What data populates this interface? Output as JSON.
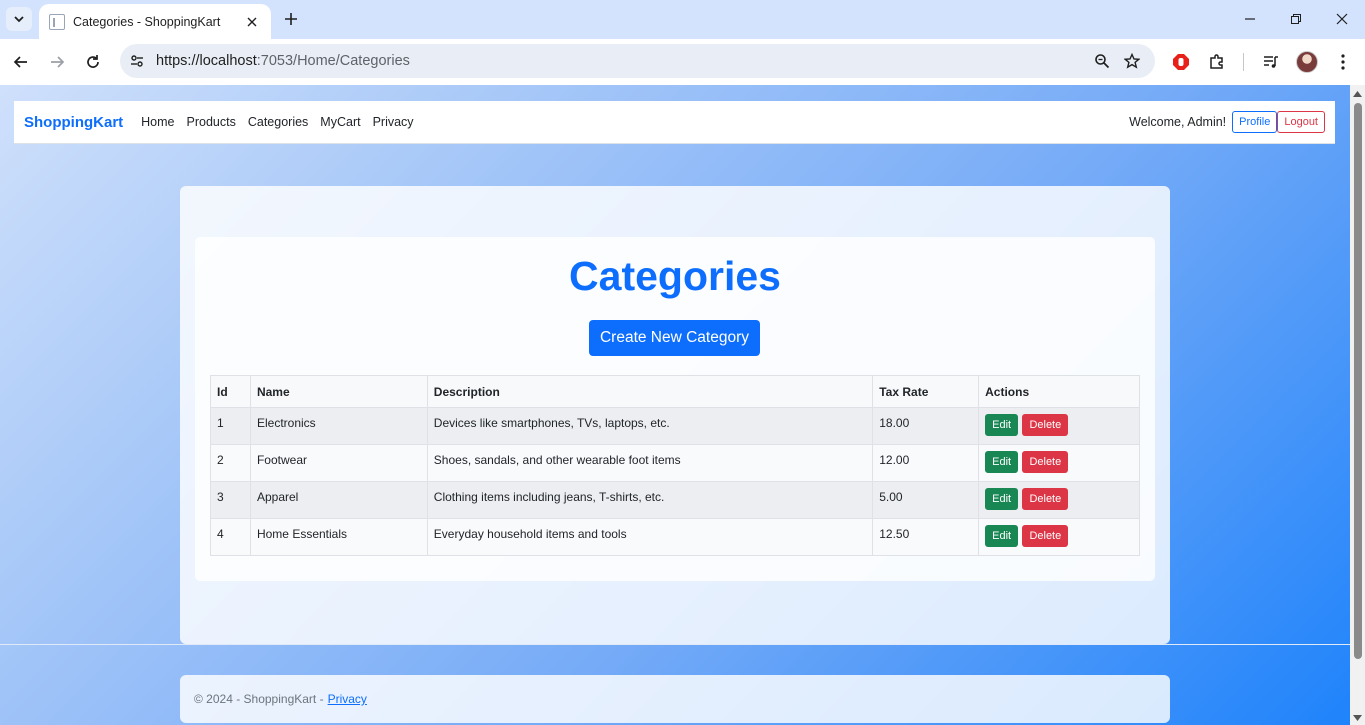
{
  "browser": {
    "tab_title": "Categories - ShoppingKart",
    "url_host": "https://localhost",
    "url_rest": ":7053/Home/Categories"
  },
  "site": {
    "brand": "ShoppingKart",
    "nav": [
      "Home",
      "Products",
      "Categories",
      "MyCart",
      "Privacy"
    ],
    "welcome": "Welcome, Admin!",
    "profile_label": "Profile",
    "logout_label": "Logout"
  },
  "main": {
    "title": "Categories",
    "create_label": "Create New Category",
    "table": {
      "headers": [
        "Id",
        "Name",
        "Description",
        "Tax Rate",
        "Actions"
      ],
      "rows": [
        {
          "id": "1",
          "name": "Electronics",
          "description": "Devices like smartphones, TVs, laptops, etc.",
          "tax_rate": "18.00"
        },
        {
          "id": "2",
          "name": "Footwear",
          "description": "Shoes, sandals, and other wearable foot items",
          "tax_rate": "12.00"
        },
        {
          "id": "3",
          "name": "Apparel",
          "description": "Clothing items including jeans, T-shirts, etc.",
          "tax_rate": "5.00"
        },
        {
          "id": "4",
          "name": "Home Essentials",
          "description": "Everyday household items and tools",
          "tax_rate": "12.50"
        }
      ],
      "edit_label": "Edit",
      "delete_label": "Delete"
    }
  },
  "footer": {
    "copyright": "© 2024 - ShoppingKart -",
    "privacy_link": "Privacy"
  },
  "colors": {
    "primary": "#0d6efd",
    "success": "#198754",
    "danger": "#dc3545"
  }
}
